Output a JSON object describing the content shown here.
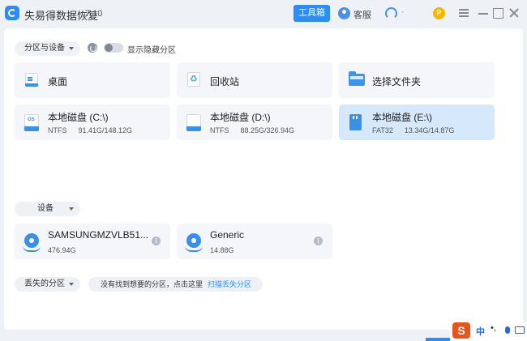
{
  "app": {
    "title": "失易得数据恢复",
    "version": "7.10",
    "toolbox_label": "工具箱",
    "service_label": "客服",
    "account_label": "·",
    "coin_symbol": "P"
  },
  "partitions": {
    "dropdown_label": "分区与设备",
    "toggle_label": "显示隐藏分区",
    "locations": [
      {
        "label": "桌面",
        "icon": "desktop-icon"
      },
      {
        "label": "回收站",
        "icon": "recycle-bin-icon"
      },
      {
        "label": "选择文件夹",
        "icon": "folder-icon"
      }
    ],
    "drives": [
      {
        "label": "本地磁盘 (C:\\)",
        "fs": "NTFS",
        "usage": "91.41G/148.12G",
        "os_badge": "OS",
        "selected": false
      },
      {
        "label": "本地磁盘 (D:\\)",
        "fs": "NTFS",
        "usage": "88.25G/326.94G",
        "selected": false
      },
      {
        "label": "本地磁盘 (E:\\)",
        "fs": "FAT32",
        "usage": "13.34G/14.87G",
        "selected": true
      }
    ]
  },
  "devices": {
    "dropdown_label": "设备",
    "items": [
      {
        "label": "SAMSUNGMZVLB51...",
        "size": "476.94G"
      },
      {
        "label": "Generic",
        "size": "14.88G"
      }
    ],
    "info_symbol": "i"
  },
  "lost": {
    "dropdown_label": "丢失的分区",
    "hint_text": "没有找到想要的分区，点击这里",
    "scan_link": "扫描丢失分区"
  },
  "ime": {
    "logo": "S",
    "mode": "中",
    "punct": "•,"
  },
  "colors": {
    "accent": "#2f8cf2",
    "selected_card": "#d6e9fb",
    "card_bg": "#f4f6f9"
  }
}
